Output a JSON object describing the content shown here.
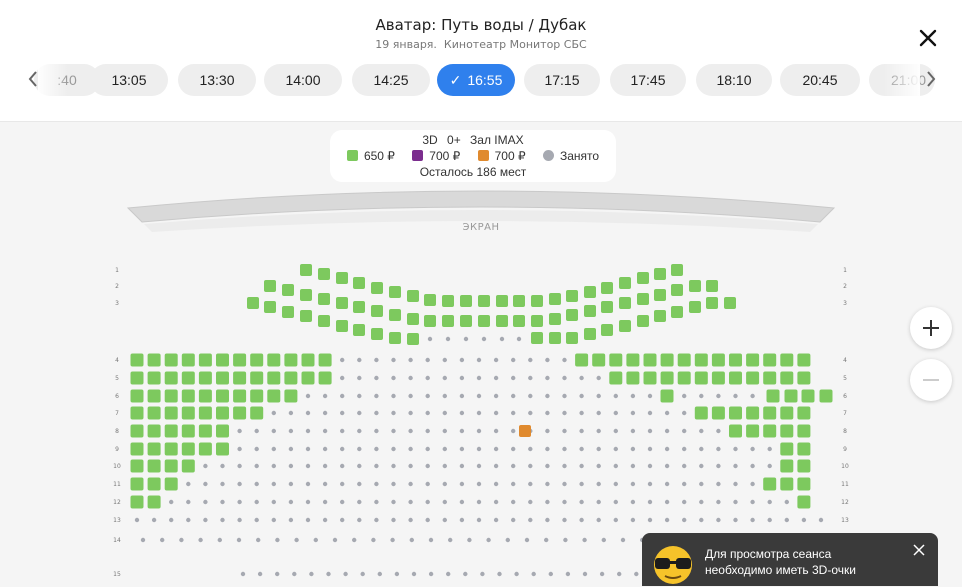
{
  "movie": {
    "title": "Аватар: Путь воды / Дубак",
    "date": "19 января.",
    "cinema": "Кинотеатр Монитор СБС"
  },
  "sessions": [
    {
      "time": ":40",
      "state": "partial"
    },
    {
      "time": "13:05",
      "state": "normal"
    },
    {
      "time": "13:30",
      "state": "normal"
    },
    {
      "time": "14:00",
      "state": "normal"
    },
    {
      "time": "14:25",
      "state": "normal"
    },
    {
      "time": "16:55",
      "state": "selected"
    },
    {
      "time": "17:15",
      "state": "normal"
    },
    {
      "time": "17:45",
      "state": "normal"
    },
    {
      "time": "18:10",
      "state": "normal"
    },
    {
      "time": "20:45",
      "state": "normal"
    },
    {
      "time": "21:00",
      "state": "partial"
    }
  ],
  "legend": {
    "format": "3D",
    "age": "0+",
    "hall": "Зал IMAX",
    "items": [
      {
        "label": "650 ₽",
        "color": "#7dc95e"
      },
      {
        "label": "700 ₽",
        "color": "#7b2d8e"
      },
      {
        "label": "700 ₽",
        "color": "#e08a2e"
      },
      {
        "label": "Занято",
        "color": "#a6a9b1"
      }
    ],
    "remaining": "Осталось 186 мест"
  },
  "screen_label": "ЭКРАН",
  "colors": {
    "accent": "#2f80ed",
    "seat_green": "#7dc95e",
    "seat_orange": "#e08a2e",
    "seat_taken": "#a6a9b1"
  },
  "hall_rows": [
    {
      "num": "1",
      "seats": 11,
      "free": [
        0,
        1,
        2,
        3,
        4,
        5,
        6,
        7,
        8,
        9,
        10
      ]
    },
    {
      "num": "2",
      "seats": 26,
      "free": "all"
    },
    {
      "num": "3",
      "seats": 28,
      "free": "all"
    },
    {
      "num": "4",
      "left_free": 12,
      "right_free": 14
    },
    {
      "num": "5",
      "left_free": 12,
      "right_free": 13
    },
    {
      "num": "6",
      "left_free": 10,
      "right_free": 3
    },
    {
      "num": "7",
      "left_free": 8,
      "right_free": 7
    },
    {
      "num": "8",
      "left_free": 6,
      "right_free": 5,
      "orange": 1
    },
    {
      "num": "9",
      "left_free": 6,
      "right_free": 2
    },
    {
      "num": "10",
      "left_free": 4,
      "right_free": 2
    },
    {
      "num": "11",
      "left_free": 3,
      "right_free": 3
    },
    {
      "num": "12",
      "left_free": 2,
      "right_free": 1
    },
    {
      "num": "13",
      "left_free": 0,
      "right_free": 0
    },
    {
      "num": "14",
      "left_free": 0,
      "right_free": 0
    },
    {
      "num": "15",
      "left_free": 0,
      "right_free": 0
    }
  ],
  "zoom": {
    "in": "+",
    "out": "−"
  },
  "toast": {
    "line1": "Для просмотра сеанса",
    "line2": "необходимо иметь 3D-очки"
  }
}
